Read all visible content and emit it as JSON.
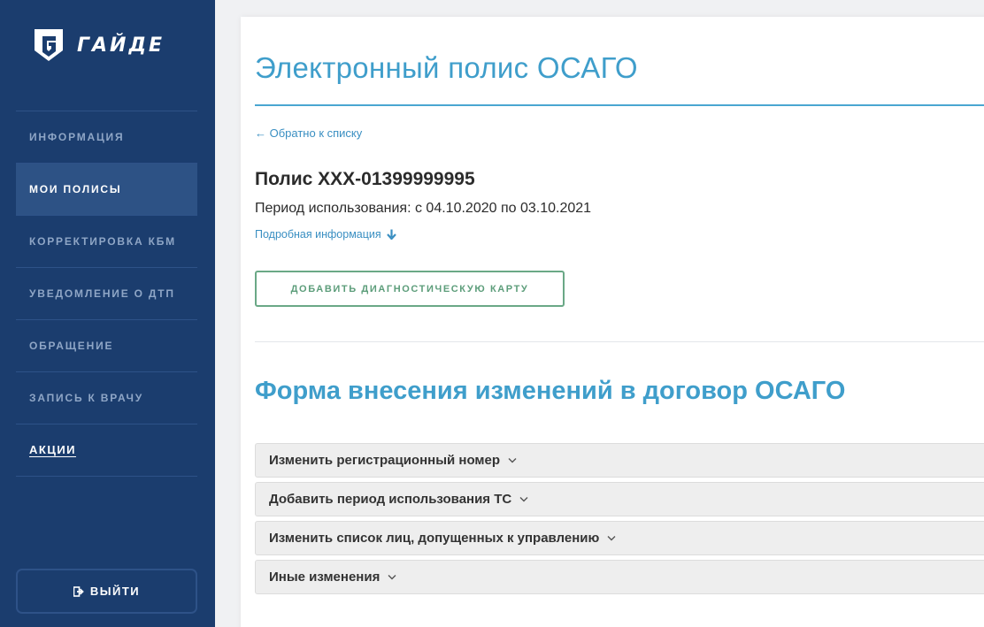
{
  "brand": {
    "name": "ГАЙДЕ"
  },
  "sidebar": {
    "items": [
      {
        "label": "ИНФОРМАЦИЯ"
      },
      {
        "label": "МОИ ПОЛИСЫ"
      },
      {
        "label": "КОРРЕКТИРОВКА КБМ"
      },
      {
        "label": "УВЕДОМЛЕНИЕ О ДТП"
      },
      {
        "label": "ОБРАЩЕНИЕ"
      },
      {
        "label": "ЗАПИСЬ К ВРАЧУ"
      },
      {
        "label": "АКЦИИ"
      }
    ],
    "active_item": "МОИ ПОЛИСЫ",
    "logout_label": "ВЫЙТИ"
  },
  "main": {
    "page_title": "Электронный полис ОСАГО",
    "back_link": "← Обратно к списку",
    "policy_title": "Полис ХХХ-01399999995",
    "policy_period": "Период использования: с 04.10.2020 по 03.10.2021",
    "more_info": "Подробная информация",
    "diagnostic_button": "ДОБАВИТЬ ДИАГНОСТИЧЕСКУЮ КАРТУ",
    "form_title": "Форма внесения изменений в договор ОСАГО",
    "accordion": [
      {
        "label": "Изменить регистрационный номер"
      },
      {
        "label": "Добавить период использования ТС"
      },
      {
        "label": "Изменить список лиц, допущенных к управлению"
      },
      {
        "label": "Иные изменения"
      }
    ]
  },
  "colors": {
    "sidebar_bg": "#1b3d6e",
    "sidebar_active": "#2d5285",
    "accent_blue": "#3f9ecb",
    "link_blue": "#3a8fc2",
    "green_button": "#5c9d7a"
  },
  "icons": {
    "logo": "guide-shield-logo",
    "logout": "logout-icon",
    "more_info": "arrow-down-icon",
    "accordion": "chevron-down-icon"
  }
}
